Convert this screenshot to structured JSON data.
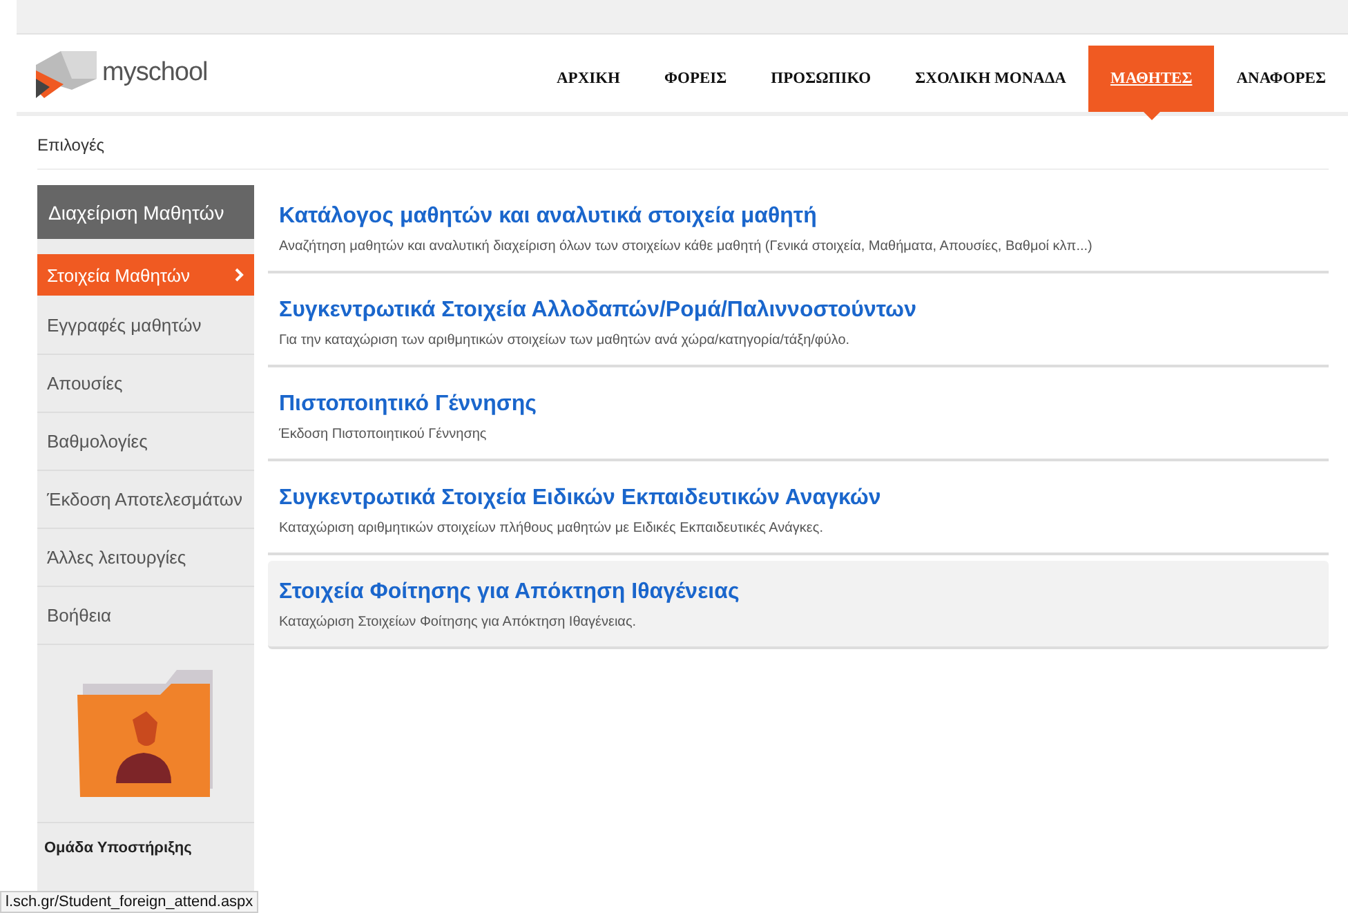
{
  "header": {
    "logo_text": "myschool",
    "nav": [
      {
        "label": "ΑΡΧΙΚΗ",
        "selected": false
      },
      {
        "label": "ΦΟΡΕΙΣ",
        "selected": false
      },
      {
        "label": "ΠΡΟΣΩΠΙΚΟ",
        "selected": false
      },
      {
        "label": "ΣΧΟΛΙΚΗ ΜΟΝΑΔΑ",
        "selected": false
      },
      {
        "label": "ΜΑΘΗΤΕΣ",
        "selected": true
      },
      {
        "label": "ΑΝΑΦΟΡΕΣ",
        "selected": false
      }
    ]
  },
  "breadcrumb": "Επιλογές",
  "sidebar": {
    "title": "Διαχείριση Μαθητών",
    "items": [
      {
        "label": "Στοιχεία Μαθητών",
        "selected": true
      },
      {
        "label": "Εγγραφές μαθητών",
        "selected": false
      },
      {
        "label": "Απουσίες",
        "selected": false
      },
      {
        "label": "Βαθμολογίες",
        "selected": false
      },
      {
        "label": "Έκδοση Αποτελεσμάτων",
        "selected": false
      },
      {
        "label": "Άλλες λειτουργίες",
        "selected": false
      },
      {
        "label": "Βοήθεια",
        "selected": false
      }
    ],
    "support_title": "Ομάδα Υποστήριξης"
  },
  "options": [
    {
      "title": "Κατάλογος μαθητών και αναλυτικά στοιχεία μαθητή",
      "description": "Αναζήτηση μαθητών και αναλυτική διαχείριση όλων των στοιχείων κάθε μαθητή (Γενικά στοιχεία, Μαθήματα, Απουσίες, Βαθμοί κλπ...)",
      "highlighted": false
    },
    {
      "title": "Συγκεντρωτικά Στοιχεία Αλλοδαπών/Ρομά/Παλιννοστούντων",
      "description": "Για την καταχώριση των αριθμητικών στοιχείων των μαθητών ανά χώρα/κατηγορία/τάξη/φύλο.",
      "highlighted": false
    },
    {
      "title": "Πιστοποιητικό Γέννησης",
      "description": "Έκδοση Πιστοποιητικού Γέννησης",
      "highlighted": false
    },
    {
      "title": "Συγκεντρωτικά Στοιχεία Ειδικών Εκπαιδευτικών Αναγκών",
      "description": "Καταχώριση αριθμητικών στοιχείων πλήθους μαθητών με Ειδικές Εκπαιδευτικές Ανάγκες.",
      "highlighted": false
    },
    {
      "title": "Στοιχεία Φοίτησης για Απόκτηση Ιθαγένειας",
      "description": "Καταχώριση Στοιχείων Φοίτησης για Απόκτηση Ιθαγένειας.",
      "highlighted": true
    }
  ],
  "status_bar": {
    "url": "l.sch.gr/Student_foreign_attend.aspx"
  }
}
